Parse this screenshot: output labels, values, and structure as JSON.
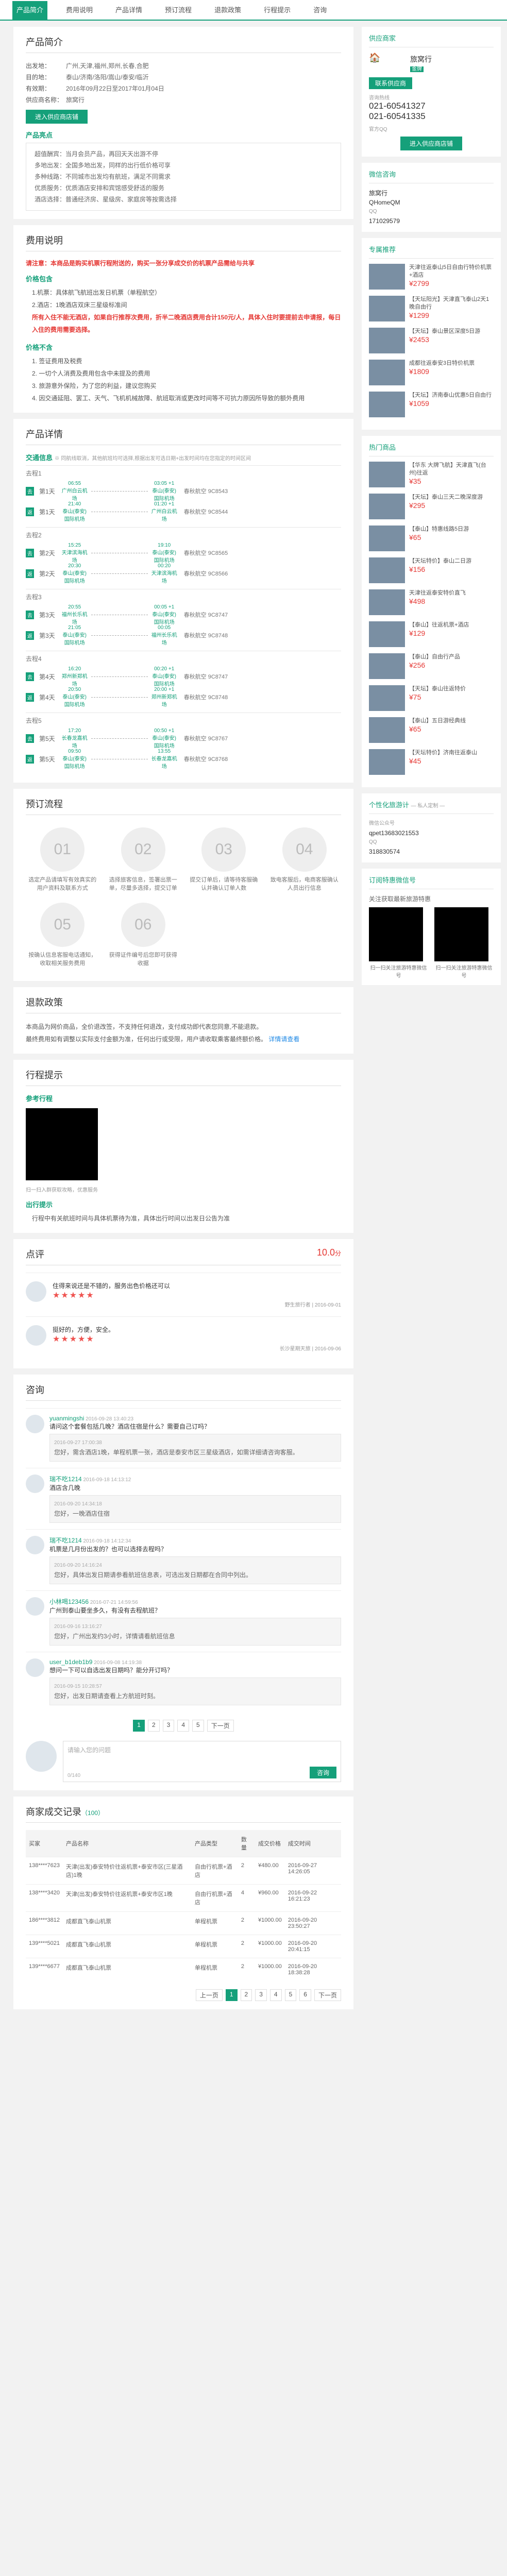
{
  "tabs": [
    "产品简介",
    "费用说明",
    "产品详情",
    "预订流程",
    "退款政策",
    "行程提示",
    "咨询"
  ],
  "intro": {
    "title": "产品简介",
    "rows": [
      [
        "出发地：",
        "广州,天津,福州,郑州,长春,合肥"
      ],
      [
        "目的地：",
        "泰山/济南/洛阳/嵩山/泰安/临沂"
      ],
      [
        "有效期：",
        "2016年09月22日至2017年01月04日"
      ],
      [
        "供应商名称：",
        "旅窝行"
      ]
    ],
    "btn": "进入供应商店铺",
    "feature_title": "产品亮点",
    "features": [
      "超值酬宾：当月会员产品，再回天天出游不停",
      "多地出发：全国多地出发，同样的出行低价格可享",
      "多种线路：不同城市出发均有航班，满足不同需求",
      "优质服务：优质酒店安排和宾馆感受舒适的服务",
      "酒店选择：普通经济房、星级房、家庭房等按需选择"
    ]
  },
  "fee": {
    "title": "费用说明",
    "warn": "请注意：本商品是购买机票行程附送的，购买一张分享成交价的机票产品需给与共享",
    "include_title": "价格包含",
    "include": [
      "1.机票：具体航飞航班出发日机票（单程航空）",
      "2.酒店：1晚酒店双床三星级标准间",
      "所有入住不能无酒店，如果自行推荐次费用，折半二晚酒店费用合计150元/人，具体入住时要提前去申请报，每日入住的费用需要选择。"
    ],
    "exclude_title": "价格不含",
    "exclude": [
      "1. 签证费用及税费",
      "2. 一切个人消费及费用包含中未提及的费用",
      "3. 旅游意外保险，为了您的利益，建议您购买",
      "4. 因交通延阻、罢工、天气、飞机机械故障、航班取消或更改时间等不可抗力原因所导致的额外费用"
    ]
  },
  "detail": {
    "title": "产品详情",
    "sub_title": "交通信息",
    "sub_note": "※ 同航线取消，其他航班均可选择,根据出发可选日期+出发时间均在您指定的时间区间",
    "days": [
      {
        "label": "去程1",
        "flights": [
          [
            "06:55",
            "03:05 +1",
            "广州白云机场",
            "泰山(泰安)国际机场",
            "春秋航空 9C8543"
          ],
          [
            "21:40",
            "01:20 +1",
            "泰山(泰安)国际机场",
            "广州白云机场",
            "春秋航空 9C8544"
          ]
        ]
      },
      {
        "label": "去程2",
        "flights": [
          [
            "15:25",
            "19:10",
            "天津滨海机场",
            "泰山(泰安)国际机场",
            "春秋航空 9C8565"
          ],
          [
            "20:30",
            "00:20",
            "泰山(泰安)国际机场",
            "天津滨海机场",
            "春秋航空 9C8566"
          ]
        ]
      },
      {
        "label": "去程3",
        "flights": [
          [
            "20:55",
            "00:05 +1",
            "福州长乐机场",
            "泰山(泰安)国际机场",
            "春秋航空 9C8747"
          ],
          [
            "21:05",
            "00:05",
            "泰山(泰安)国际机场",
            "福州长乐机场",
            "春秋航空 9C8748"
          ]
        ]
      },
      {
        "label": "去程4",
        "flights": [
          [
            "16:20",
            "00:20 +1",
            "郑州新郑机场",
            "泰山(泰安)国际机场",
            "春秋航空 9C8747"
          ],
          [
            "20:50",
            "20:00 +1",
            "泰山(泰安)国际机场",
            "郑州新郑机场",
            "春秋航空 9C8748"
          ]
        ]
      },
      {
        "label": "去程5",
        "flights": [
          [
            "17:20",
            "00:50 +1",
            "长春龙嘉机场",
            "泰山(泰安)国际机场",
            "春秋航空 9C8767"
          ],
          [
            "09:50",
            "13:55",
            "泰山(泰安)国际机场",
            "长春龙嘉机场",
            "春秋航空 9C8768"
          ]
        ]
      }
    ]
  },
  "flow": {
    "title": "预订流程",
    "steps": [
      "选定产品请填写有效真实的用户资料及联系方式",
      "选择旅客信息，签署出票一单，尽量多选择，提交订单",
      "提交订单后，请等待客服确认并确认订单人数",
      "致电客服后，电商客服确认人员出行信息",
      "按确认信息客服电话通知，收取相关服务费用",
      "获得证件编号后您即可获得收据"
    ]
  },
  "refund": {
    "title": "退款政策",
    "text": "本商品为网价商品，全价退改签，不支持任何退改，支付成功即代表您同意,不能退款。",
    "text2": "最终费用如有调整以实际支付金额为准，任何出行或受限，用户请收取乘客最终额价格。",
    "link": "详情请查看"
  },
  "tips": {
    "title": "行程提示",
    "map_title": "参考行程",
    "map_caption": "扫一扫入群获取攻略，优惠服务",
    "notice_title": "出行提示",
    "notice": "行程中有关航班时间与具体机票待为准，具体出行时间以出发日公告为准"
  },
  "reviews": {
    "title": "点评",
    "score": "10.0",
    "unit": "分",
    "items": [
      {
        "text": "住得来说还是不错的，服务出色价格还可以",
        "user": "野生旅行者",
        "date": "2016-09-01",
        "stars": 5
      },
      {
        "text": "挺好的，方便，安全。",
        "user": "长沙星期天旅",
        "date": "2016-09-06",
        "stars": 5
      }
    ]
  },
  "qa": {
    "title": "咨询",
    "items": [
      {
        "user": "yuanmingshi",
        "time": "2016-09-28 13:40:23",
        "q": "请问这个套餐包括几晚？酒店住宿是什么？需要自己订吗？",
        "a": "您好，需含酒店1晚，单程机票一张，酒店是泰安市区三星级酒店，如需详细请咨询客服。",
        "atime": "2016-09-27 17:00:38"
      },
      {
        "user": "瑞不吃1214",
        "time": "2016-09-18 14:13:12",
        "q": "酒店含几晚",
        "a": "您好，一晚酒店住宿",
        "atime": "2016-09-20 14:34:18"
      },
      {
        "user": "瑞不吃1214",
        "time": "2016-09-18 14:12:34",
        "q": "机票是几月份出发的？也可以选择去程吗？",
        "a": "您好，具体出发日期请参看航班信息表，可选出发日期都在合同中列出。",
        "atime": "2016-09-20 14:16:24"
      },
      {
        "user": "小林喝123456",
        "time": "2016-07-21 14:59:56",
        "q": "广州到泰山要坐多久，有没有去程航班？",
        "a": "您好，广州出发约3小时，详情请看航班信息",
        "atime": "2016-09-16 13:16:27"
      },
      {
        "user": "user_b1deb1b9",
        "time": "2016-09-08 14:19:38",
        "q": "想问一下可以自选出发日期吗？能分开订吗？",
        "a": "您好，出发日期请查看上方航班时刻。",
        "atime": "2016-09-15 10:28:57"
      }
    ],
    "pager": [
      "1",
      "2",
      "3",
      "4",
      "5",
      "下一页"
    ],
    "placeholder": "请输入您的问题",
    "count": "0/140",
    "submit": "咨询"
  },
  "deals": {
    "title": "商家成交记录",
    "count": "（100）",
    "cols": [
      "买家",
      "产品名称",
      "产品类型",
      "数量",
      "成交价格",
      "成交时间"
    ],
    "rows": [
      [
        "138****7623",
        "天津(出发)泰安特价往返机票+泰安市区(三星酒店)1晚",
        "自由行机票+酒店",
        "2",
        "¥480.00",
        "2016-09-27 14:26:05"
      ],
      [
        "138****3420",
        "天津(出发)泰安特价往返机票+泰安市区1晚",
        "自由行机票+酒店",
        "4",
        "¥960.00",
        "2016-09-22 16:21:23"
      ],
      [
        "186****3812",
        "成都直飞泰山机票",
        "单程机票",
        "2",
        "¥1000.00",
        "2016-09-20 23:50:27"
      ],
      [
        "139****5021",
        "成都直飞泰山机票",
        "单程机票",
        "2",
        "¥1000.00",
        "2016-09-20 20:41:15"
      ],
      [
        "139****6677",
        "成都直飞泰山机票",
        "单程机票",
        "2",
        "¥1000.00",
        "2016-09-20 18:38:28"
      ]
    ],
    "pager": [
      "上一页",
      "1",
      "2",
      "3",
      "4",
      "5",
      "6",
      "下一页"
    ]
  },
  "vendor": {
    "title": "供应商家",
    "name": "旅窝行",
    "level": "金牌",
    "phone_label": "咨询热线",
    "phones": [
      "021-60541327",
      "021-60541335"
    ],
    "qq": "官方QQ",
    "btn_contact": "联系供应商",
    "btn_store": "进入供应商店铺"
  },
  "wechat": {
    "title": "微信咨询",
    "name": "旅窝行",
    "id": "QHomeQM",
    "qq_label": "QQ",
    "qq": "171029579"
  },
  "recommend": {
    "title": "专属推荐",
    "items": [
      {
        "t": "天津往返泰山5日自由行特价机票+酒店",
        "p": "¥2799"
      },
      {
        "t": "【天坛阳光】天津直飞泰山2天1晚自由行",
        "p": "¥1299"
      },
      {
        "t": "【天坛】泰山景区深度5日游",
        "p": "¥2453"
      },
      {
        "t": "成都往返泰安3日特价机票",
        "p": "¥1809"
      },
      {
        "t": "【天坛】济南泰山优惠5日自由行",
        "p": "¥1059"
      }
    ]
  },
  "hot": {
    "title": "热门商品",
    "items": [
      {
        "t": "【华东 大牌飞航】天津直飞(台州)往返",
        "p": "¥35"
      },
      {
        "t": "【天坛】泰山三天二晚深度游",
        "p": "¥295"
      },
      {
        "t": "【泰山】特惠线路5日游",
        "p": "¥65"
      },
      {
        "t": "【天坛特价】泰山二日游",
        "p": "¥156"
      },
      {
        "t": "天津往返泰安特价直飞",
        "p": "¥498"
      },
      {
        "t": "【泰山】往返机票+酒店",
        "p": "¥129"
      },
      {
        "t": "【泰山】自由行产品",
        "p": "¥256"
      },
      {
        "t": "【天坛】泰山往返特价",
        "p": "¥75"
      },
      {
        "t": "【泰山】五日游经典线",
        "p": "¥65"
      },
      {
        "t": "【天坛特价】济南往返泰山",
        "p": "¥45"
      }
    ]
  },
  "guide": {
    "title": "个性化旅游计",
    "note": "— 私人定制 —",
    "wechat_label": "微信公众号",
    "wechat": "qpet13683021553",
    "qq_label": "QQ",
    "qq": "318830574"
  },
  "wx": {
    "title": "订阅特惠微信号",
    "subtitle": "关注获取最新旅游特惠",
    "codes": [
      "扫一扫关注旅游特惠微信号",
      "扫一扫关注旅游特惠微信号"
    ]
  },
  "colors": {
    "accent": "#15a07a",
    "price": "#e53935"
  }
}
